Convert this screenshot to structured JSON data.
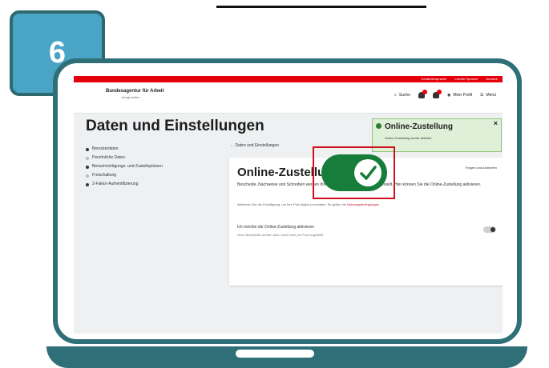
{
  "step_number": "6",
  "brand_colors": {
    "teal": "#2f6f78",
    "badge": "#4aa4c5",
    "red": "#e3000b",
    "green": "#177d3a"
  },
  "app": {
    "logo_text": "Bundesagentur für Arbeit",
    "logo_sub": "bringt weiter."
  },
  "top_links": [
    "Gebärdensprache",
    "Leichte Sprache",
    "Deutsch"
  ],
  "nav": {
    "search_label": "Suche",
    "profile_label": "Mein Profil",
    "menu_label": "Menü"
  },
  "page_title": "Daten und Einstellungen",
  "sidebar": {
    "items": [
      {
        "label": "Benutzerdaten"
      },
      {
        "label": "Persönliche Daten"
      },
      {
        "label": "Benachrichtigungs- und Zustelloptionen"
      },
      {
        "label": "Freischaltung"
      },
      {
        "label": "2-Faktor-Authentifizierung"
      }
    ]
  },
  "breadcrumb": "Daten und Einstellungen",
  "card": {
    "title": "Online-Zustellung",
    "help_link": "Fragen und Antworten",
    "description": "Bescheide, Nachweise und Schreiben werden Ihnen standardmäßig per Post zugestellt. Hier können Sie die Online-Zustellung aktivieren.",
    "note_text": "Aktivieren Sie die Einwilligung, um Ihre Post digital zu erhalten. Es gelten die",
    "note_link": "Nutzungsbedingungen",
    "toggle_label": "Ich möchte die Online-Zustellung aktivieren",
    "toggle_sub": "Neue Bescheide werden dann nicht mehr per Post zugestellt.",
    "toggle_on": true
  },
  "toast": {
    "title": "Online-Zustellung",
    "text": "Online-Zustellung wurde aktiviert."
  }
}
